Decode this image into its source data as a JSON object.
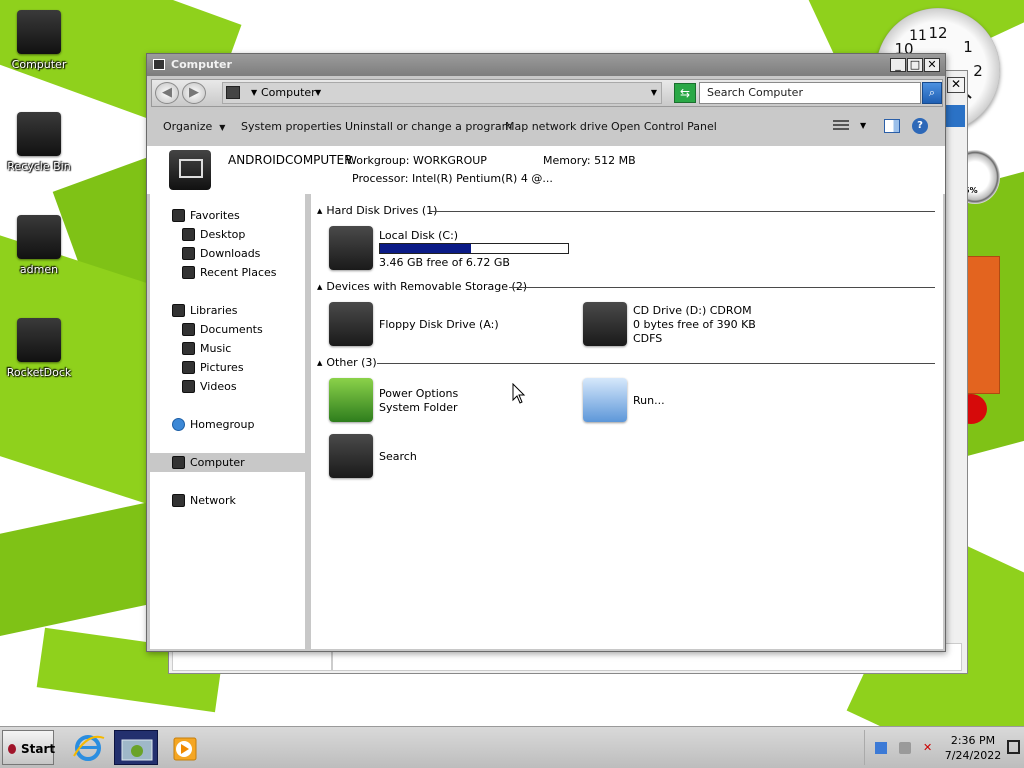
{
  "desktop": {
    "icons": [
      {
        "label": "Computer"
      },
      {
        "label": "Recycle Bin"
      },
      {
        "label": "admen"
      },
      {
        "label": "RocketDock"
      }
    ],
    "wallpaper_colors": {
      "green": "#8fd11c",
      "white": "#ffffff"
    },
    "cpu_gauge_text": "5%"
  },
  "window": {
    "title": "Computer",
    "controls": {
      "minimize": "_",
      "maximize": "□",
      "close": "✕"
    },
    "address": {
      "location": "Computer",
      "back": "◀",
      "forward": "▶"
    },
    "search": {
      "placeholder": "Search Computer",
      "value": "Search Computer"
    },
    "toolbar": {
      "organize": "Organize",
      "system_properties": "System properties",
      "uninstall": "Uninstall or change a program",
      "map_drive": "Map network drive",
      "control_panel": "Open Control Panel",
      "help": "?"
    },
    "details": {
      "computer_name": "ANDROIDCOMPUTER",
      "workgroup": "Workgroup: WORKGROUP",
      "memory": "Memory: 512 MB",
      "processor": "Processor: Intel(R) Pentium(R) 4   @..."
    },
    "nav": {
      "favorites": {
        "label": "Favorites",
        "items": [
          "Desktop",
          "Downloads",
          "Recent Places"
        ]
      },
      "libraries": {
        "label": "Libraries",
        "items": [
          "Documents",
          "Music",
          "Pictures",
          "Videos"
        ]
      },
      "homegroup": "Homegroup",
      "computer": "Computer",
      "network": "Network"
    },
    "groups": {
      "hard_disks": {
        "header": "Hard Disk Drives (1)",
        "local_disk": {
          "name": "Local Disk (C:)",
          "free_text": "3.46 GB free of 6.72 GB",
          "used_fraction": 0.485
        }
      },
      "removable": {
        "header": "Devices with Removable Storage (2)",
        "floppy": {
          "name": "Floppy Disk Drive (A:)"
        },
        "cdrom": {
          "name": "CD Drive (D:) CDROM",
          "free_text": "0 bytes free of 390 KB",
          "fs": "CDFS"
        }
      },
      "other": {
        "header": "Other (3)",
        "power": {
          "name": "Power Options",
          "type": "System Folder"
        },
        "run": {
          "name": "Run..."
        },
        "search": {
          "name": "Search"
        }
      }
    }
  },
  "taskbar": {
    "start": "Start",
    "time": "2:36 PM",
    "date": "7/24/2022"
  },
  "colors": {
    "accent_bar": "#0a1a86",
    "search_button": "#2b72c6",
    "selection": "#c8c8c8"
  }
}
